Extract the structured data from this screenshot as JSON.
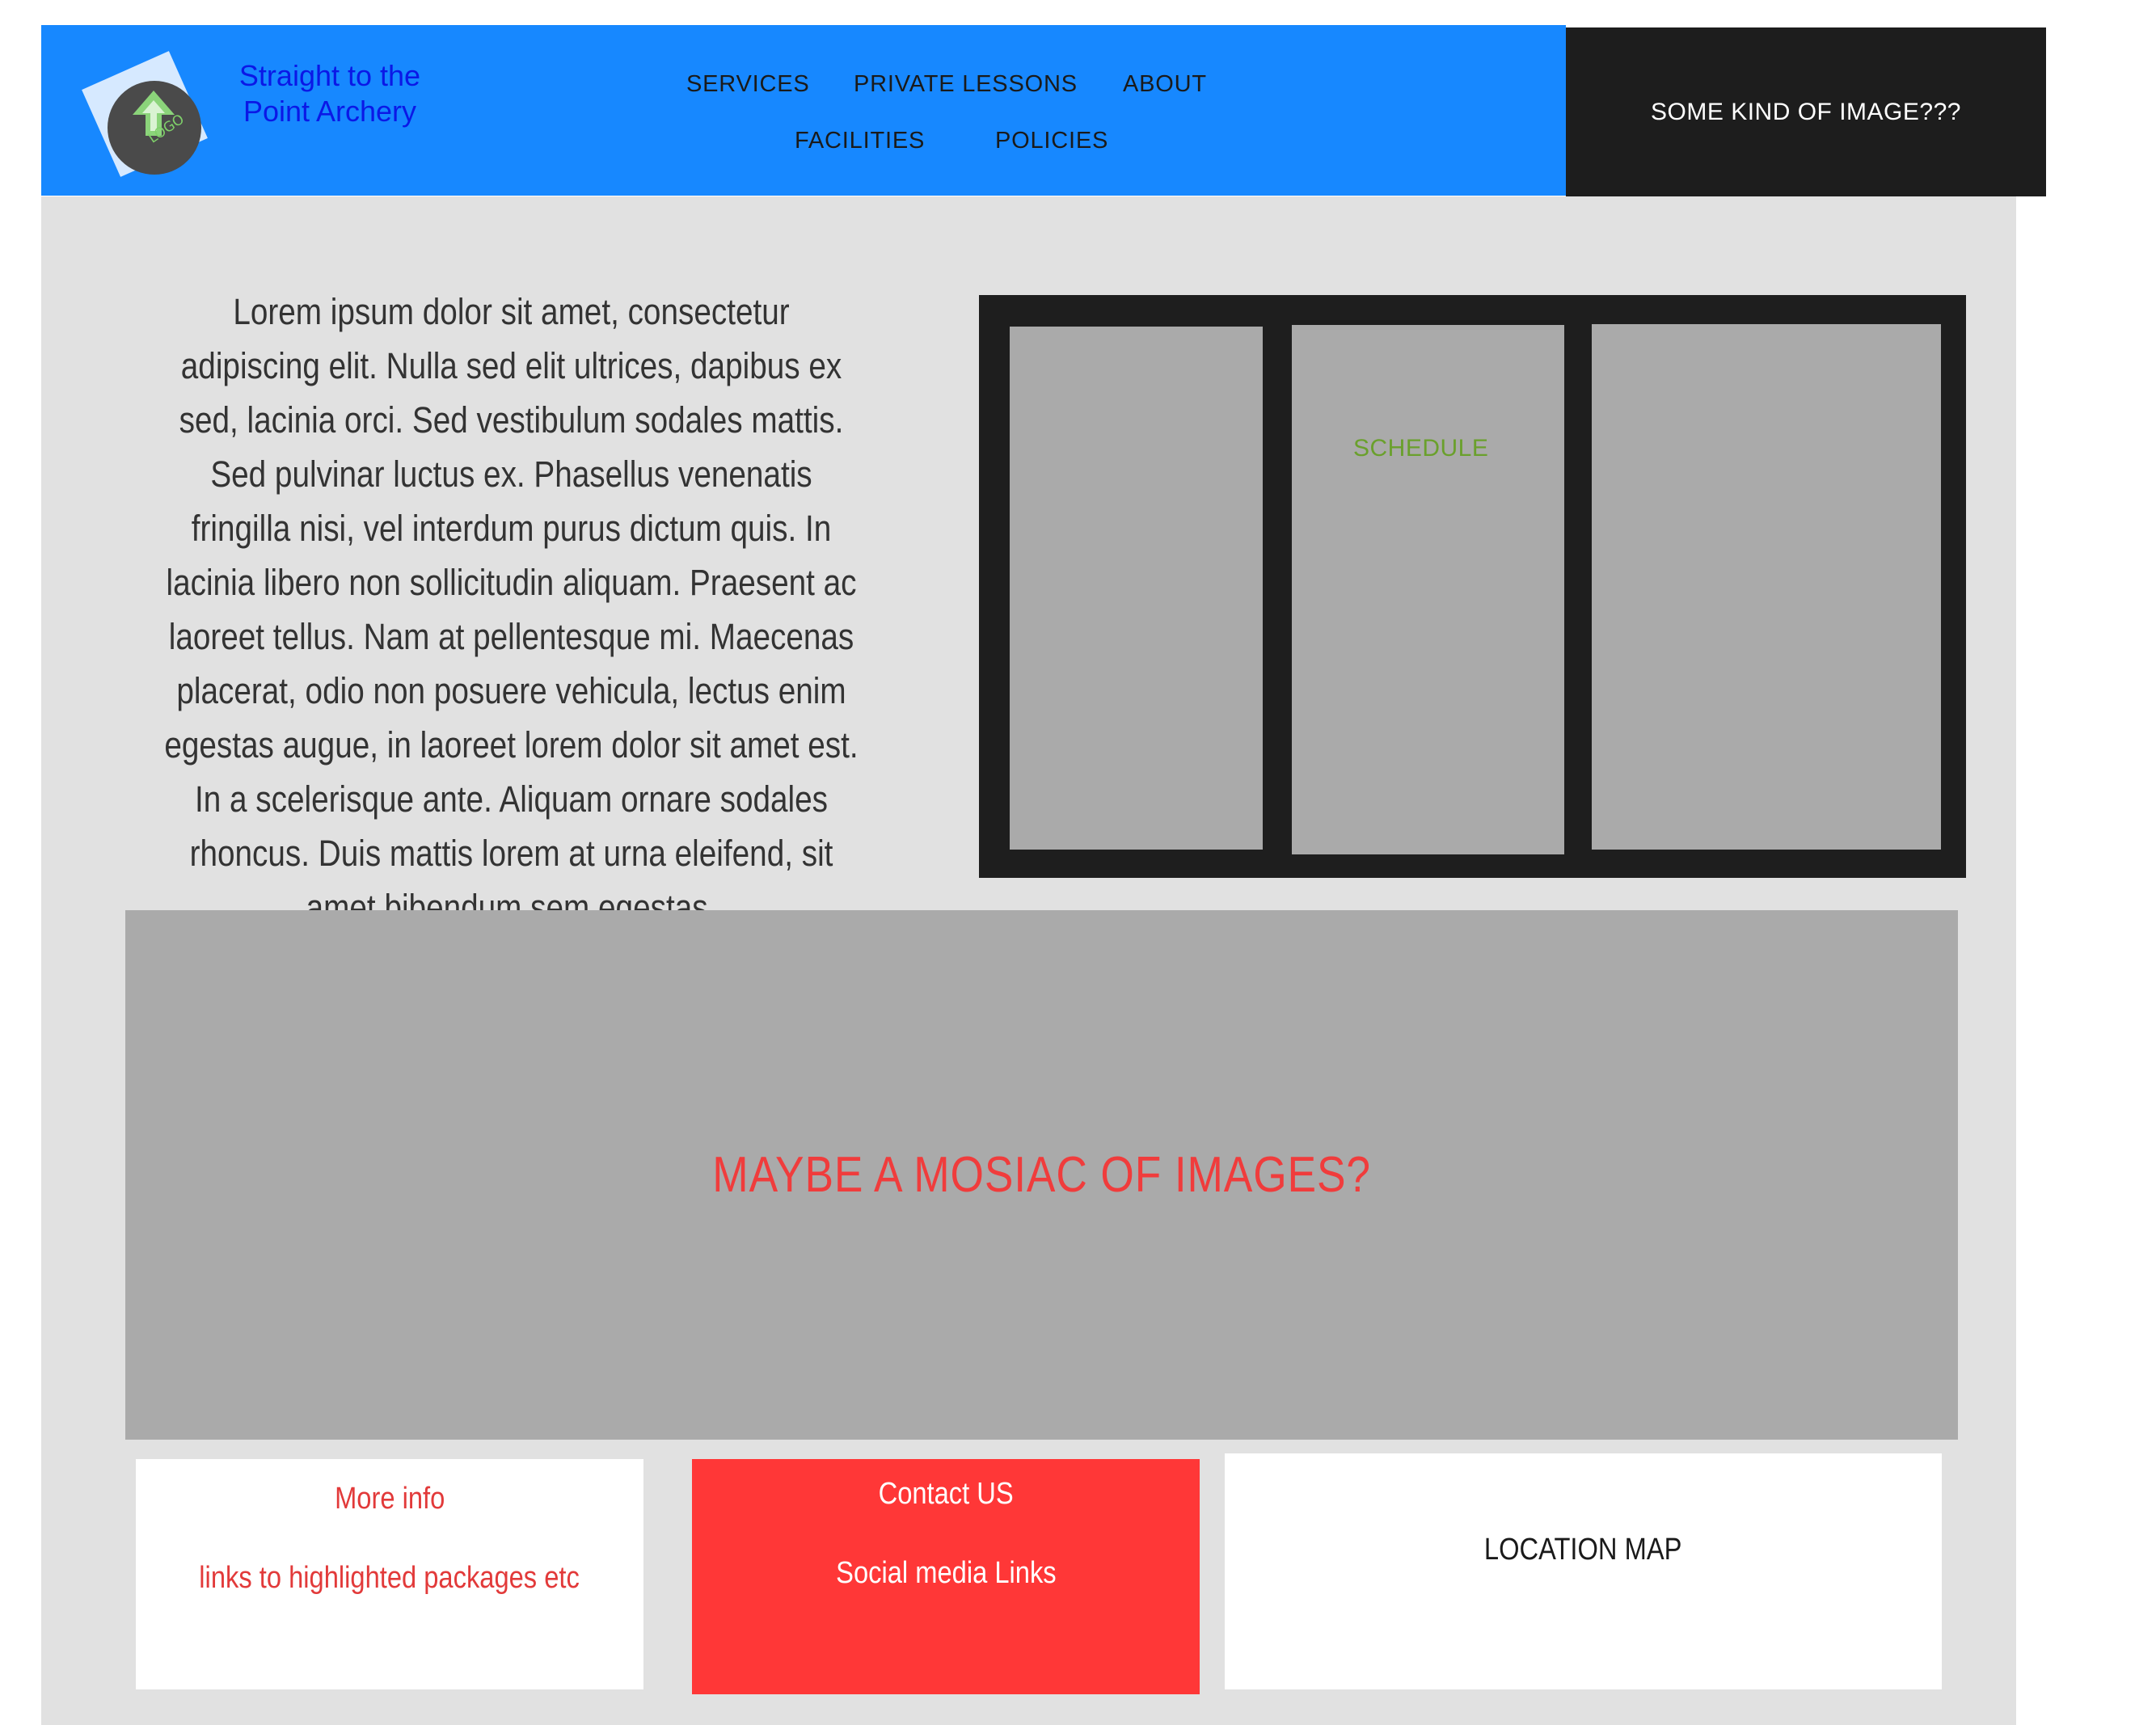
{
  "brand": {
    "logo_text": "LOGO",
    "name_line1": "Straight to the",
    "name_line2": "Point Archery"
  },
  "nav": {
    "items": [
      {
        "label": "SERVICES"
      },
      {
        "label": "PRIVATE LESSONS"
      },
      {
        "label": "ABOUT"
      },
      {
        "label": "FACILITIES"
      },
      {
        "label": "POLICIES"
      }
    ]
  },
  "header_image": {
    "label": "SOME KIND OF IMAGE???"
  },
  "intro": {
    "text": "Lorem ipsum dolor sit amet, consectetur adipiscing elit. Nulla sed elit ultrices, dapibus ex sed, lacinia orci. Sed vestibulum sodales mattis. Sed pulvinar luctus ex. Phasellus venenatis fringilla nisi, vel interdum purus dictum quis. In lacinia libero non sollicitudin aliquam. Praesent ac laoreet tellus. Nam at pellentesque mi. Maecenas placerat, odio non posuere vehicula, lectus enim egestas augue, in laoreet lorem dolor sit amet est. In a scelerisque ante. Aliquam ornare sodales rhoncus. Duis mattis lorem at urna eleifend, sit amet bibendum sem egestas."
  },
  "gallery": {
    "schedule_label": "SCHEDULE"
  },
  "mosaic": {
    "label": "MAYBE A MOSIAC OF IMAGES?"
  },
  "cards": {
    "more_info": {
      "title": "More info",
      "subtitle": "links to highlighted packages etc"
    },
    "contact": {
      "title": "Contact US",
      "subtitle": "Social media Links"
    },
    "location": {
      "title": "LOCATION MAP"
    }
  },
  "colors": {
    "header_blue": "#1788ff",
    "dark_panel": "#1d1d1d",
    "accent_red": "#ff3737",
    "schedule_green": "#6aa02c",
    "brand_text_blue": "#0b18e6",
    "placeholder_gray": "#aaaaaa",
    "page_gray": "#e1e1e1"
  },
  "icons": {
    "logo": "archery-arrow-logo-icon"
  }
}
